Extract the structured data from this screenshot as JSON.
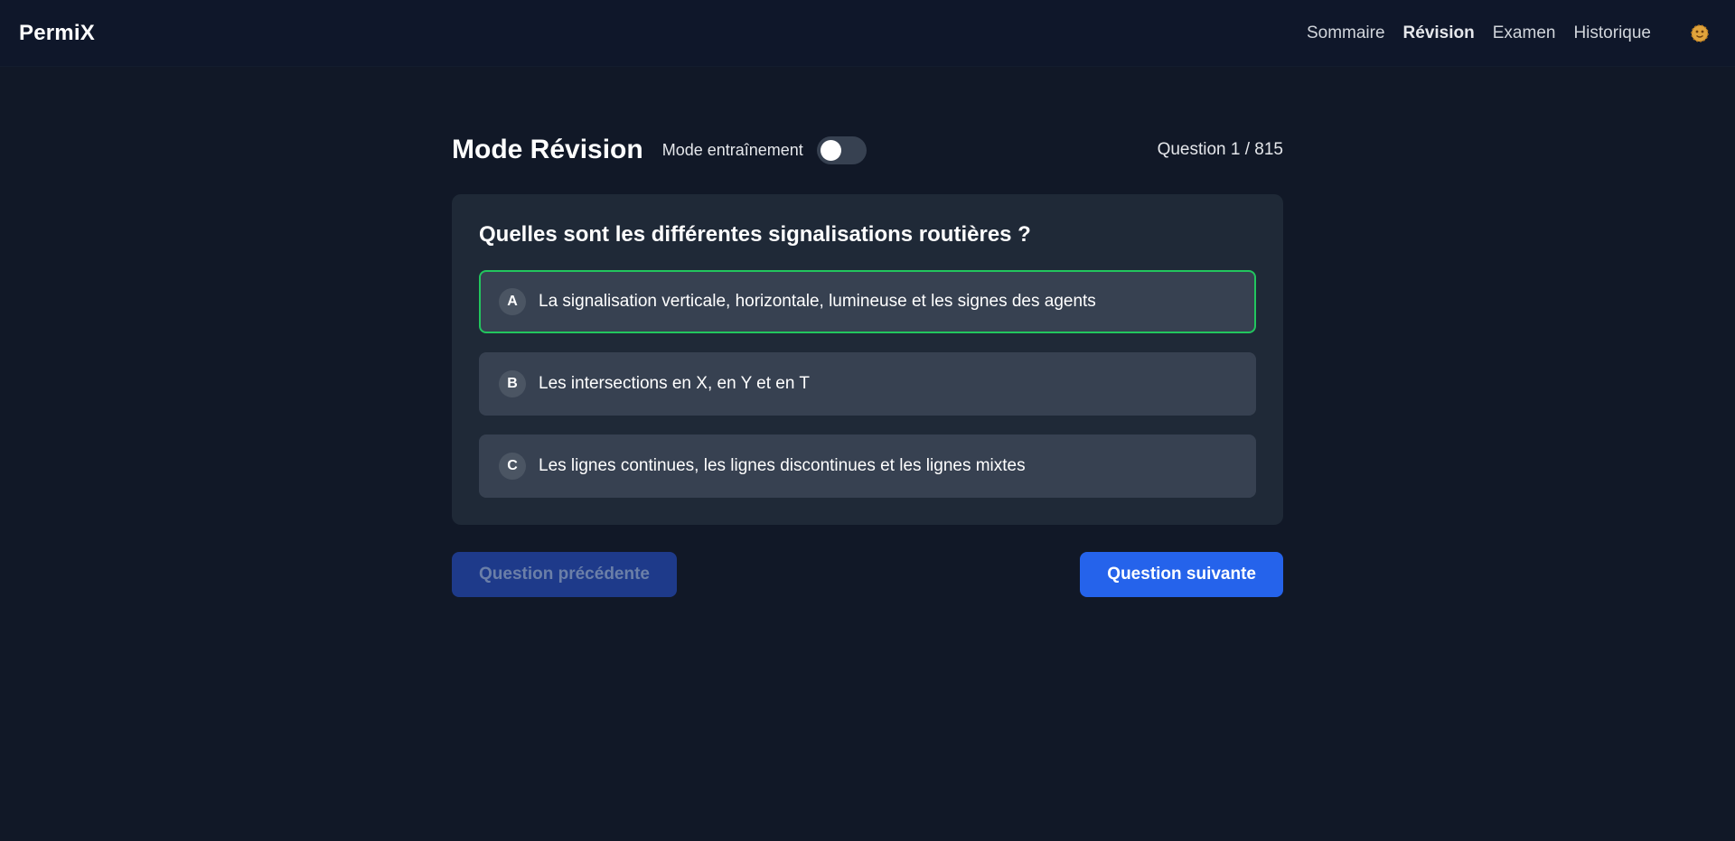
{
  "brand": "PermiX",
  "nav": {
    "links": [
      "Sommaire",
      "Révision",
      "Examen",
      "Historique"
    ],
    "active": "Révision"
  },
  "header": {
    "title": "Mode Révision",
    "mode_label": "Mode entraînement",
    "mode_enabled": false,
    "counter": "Question 1 / 815"
  },
  "question": {
    "text": "Quelles sont les différentes signalisations routières ?",
    "options": [
      {
        "letter": "A",
        "text": "La signalisation verticale, horizontale, lumineuse et les signes des agents",
        "selected": true
      },
      {
        "letter": "B",
        "text": "Les intersections en X, en Y et en T",
        "selected": false
      },
      {
        "letter": "C",
        "text": "Les lignes continues, les lignes discontinues et les lignes mixtes",
        "selected": false
      }
    ]
  },
  "buttons": {
    "prev": "Question précédente",
    "next": "Question suivante"
  },
  "colors": {
    "background": "#111827",
    "card": "#1f2937",
    "option": "#374151",
    "selected_border": "#22c55e",
    "primary": "#2563eb"
  },
  "icons": {
    "avatar": "cookie-avatar-icon"
  }
}
